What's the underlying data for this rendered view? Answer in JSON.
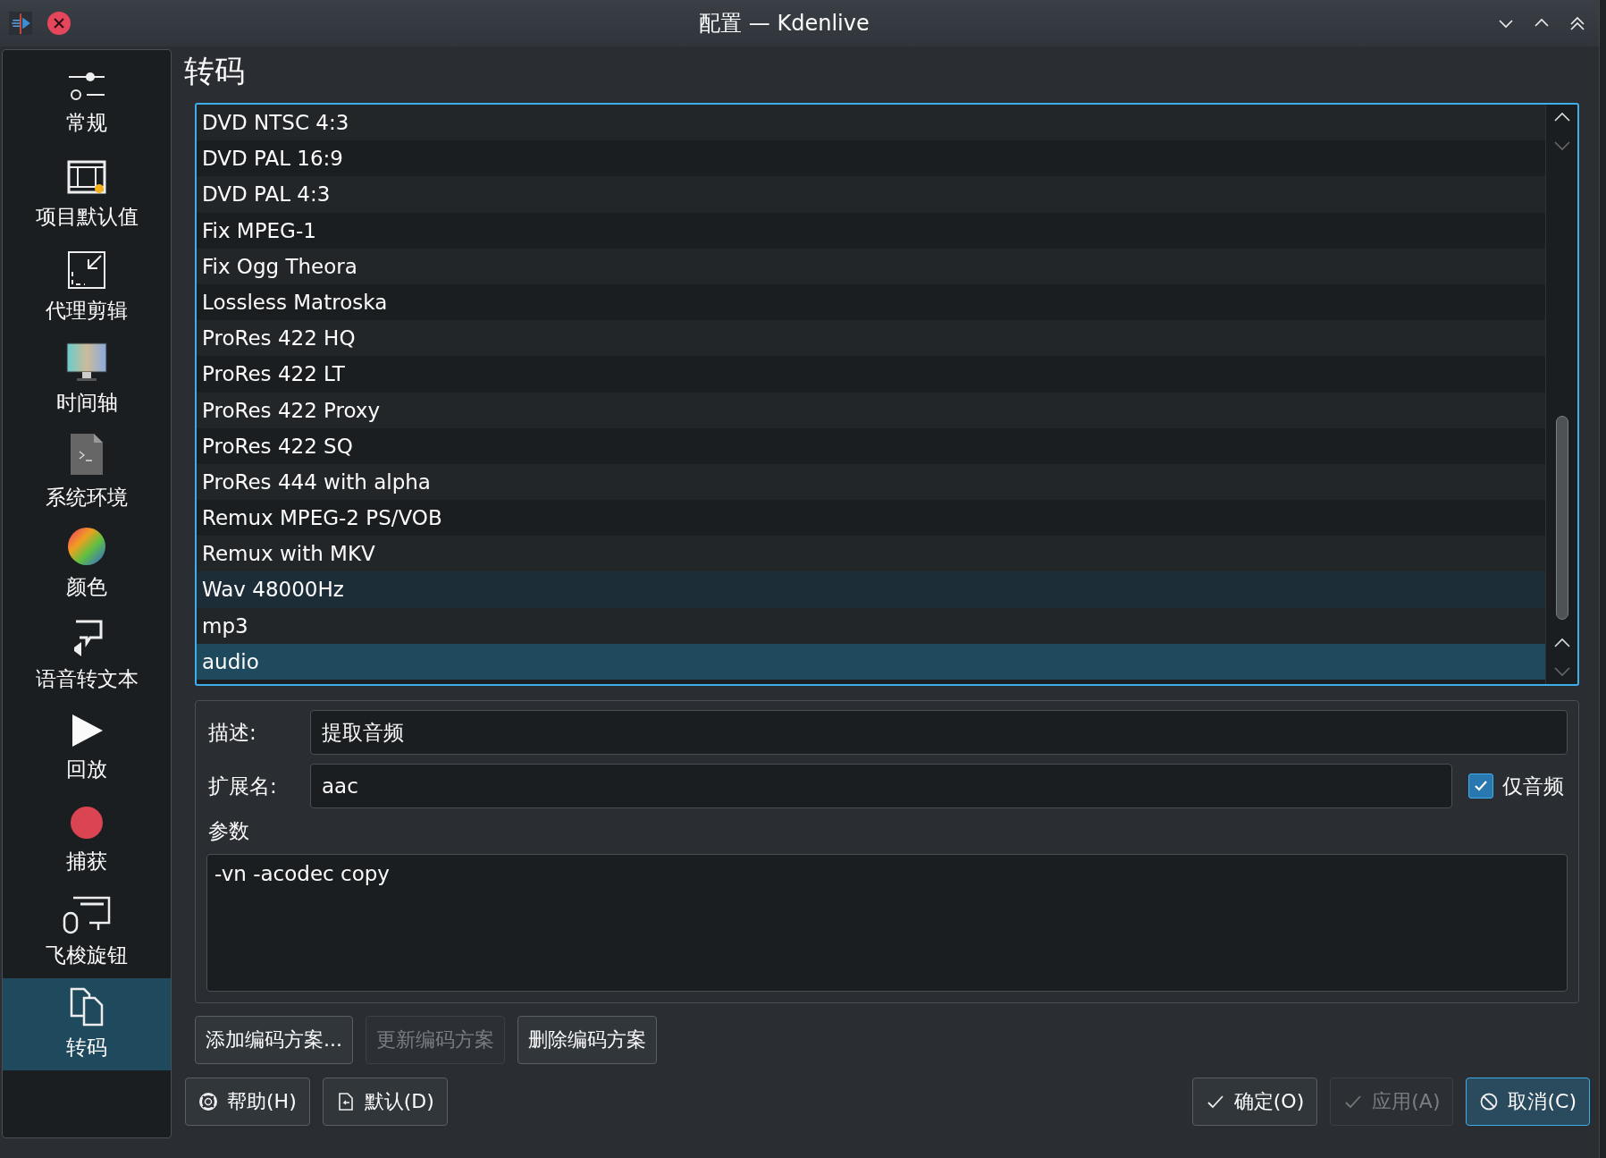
{
  "window": {
    "title": "配置 — Kdenlive"
  },
  "sidebar": {
    "items": [
      {
        "label": "常规",
        "selected": false
      },
      {
        "label": "项目默认值",
        "selected": false
      },
      {
        "label": "代理剪辑",
        "selected": false
      },
      {
        "label": "时间轴",
        "selected": false
      },
      {
        "label": "系统环境",
        "selected": false
      },
      {
        "label": "颜色",
        "selected": false
      },
      {
        "label": "语音转文本",
        "selected": false
      },
      {
        "label": "回放",
        "selected": false
      },
      {
        "label": "捕获",
        "selected": false
      },
      {
        "label": "飞梭旋钮",
        "selected": false
      },
      {
        "label": "转码",
        "selected": true
      }
    ]
  },
  "page_title": "转码",
  "profiles": [
    {
      "label": "DVD NTSC 4:3",
      "selected": false,
      "hovered": false
    },
    {
      "label": "DVD PAL 16:9",
      "selected": false,
      "hovered": false
    },
    {
      "label": "DVD PAL 4:3",
      "selected": false,
      "hovered": false
    },
    {
      "label": "Fix MPEG-1",
      "selected": false,
      "hovered": false
    },
    {
      "label": "Fix Ogg Theora",
      "selected": false,
      "hovered": false
    },
    {
      "label": "Lossless Matroska",
      "selected": false,
      "hovered": false
    },
    {
      "label": "ProRes 422 HQ",
      "selected": false,
      "hovered": false
    },
    {
      "label": "ProRes 422 LT",
      "selected": false,
      "hovered": false
    },
    {
      "label": "ProRes 422 Proxy",
      "selected": false,
      "hovered": false
    },
    {
      "label": "ProRes 422 SQ",
      "selected": false,
      "hovered": false
    },
    {
      "label": "ProRes 444 with alpha",
      "selected": false,
      "hovered": false
    },
    {
      "label": "Remux MPEG-2 PS/VOB",
      "selected": false,
      "hovered": false
    },
    {
      "label": "Remux with MKV",
      "selected": false,
      "hovered": false
    },
    {
      "label": "Wav 48000Hz",
      "selected": false,
      "hovered": true
    },
    {
      "label": "mp3",
      "selected": false,
      "hovered": false
    },
    {
      "label": "audio",
      "selected": true,
      "hovered": false
    }
  ],
  "form": {
    "description_label": "描述:",
    "description": "提取音频",
    "extension_label": "扩展名:",
    "extension": "aac",
    "audio_only": {
      "label": "仅音频",
      "checked": true
    },
    "params_label": "参数",
    "params": "-vn -acodec copy"
  },
  "profile_buttons": [
    {
      "label": "添加编码方案...",
      "disabled": false
    },
    {
      "label": "更新编码方案",
      "disabled": true
    },
    {
      "label": "删除编码方案",
      "disabled": false
    }
  ],
  "dialog_buttons_left": [
    {
      "label": "帮助(H)",
      "kind": "help",
      "disabled": false,
      "focused": false
    },
    {
      "label": "默认(D)",
      "kind": "defaults",
      "disabled": false,
      "focused": false
    }
  ],
  "dialog_buttons_right": [
    {
      "label": "确定(O)",
      "kind": "ok",
      "disabled": false,
      "focused": false
    },
    {
      "label": "应用(A)",
      "kind": "ok",
      "disabled": true,
      "focused": false
    },
    {
      "label": "取消(C)",
      "kind": "cancel",
      "disabled": false,
      "focused": true
    }
  ]
}
